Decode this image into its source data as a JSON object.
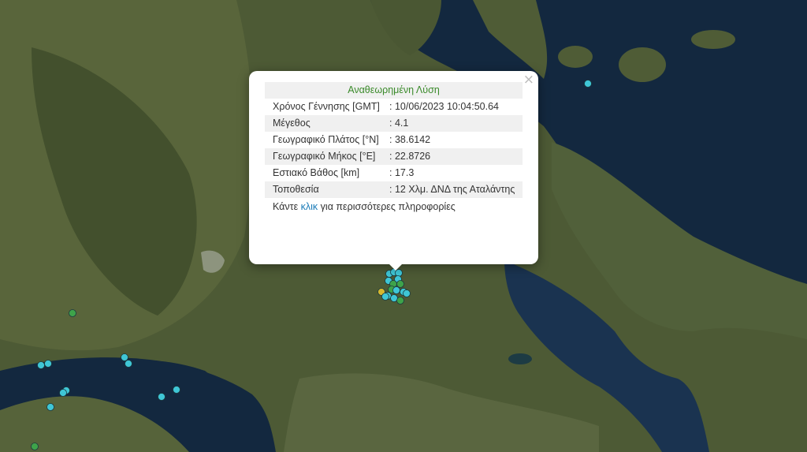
{
  "popup": {
    "close_label": "×",
    "title": "Αναθεωρημένη Λύση",
    "rows": [
      {
        "label": "Χρόνος Γέννησης [GMT]",
        "value": ": 10/06/2023 10:04:50.64"
      },
      {
        "label": "Μέγεθος",
        "value": ": 4.1"
      },
      {
        "label": "Γεωγραφικό Πλάτος [°N]",
        "value": ": 38.6142"
      },
      {
        "label": "Γεωγραφικό Μήκος [°E]",
        "value": ": 22.8726"
      },
      {
        "label": "Εστιακό Βάθος [km]",
        "value": ": 17.3"
      },
      {
        "label": "Τοποθεσία",
        "value": ": 12 Χλμ. ΔΝΔ της Αταλάντης"
      }
    ],
    "more_prefix": "Κάντε",
    "more_link": "κλικ",
    "more_suffix": "για περισσότερες πληροφορίες"
  },
  "colors": {
    "marker_cyan": "#3fc6d6",
    "marker_green": "#3ea34a",
    "marker_yellow": "#d6b82e",
    "title_green": "#3a8a2a",
    "link_blue": "#1a7bb8"
  }
}
